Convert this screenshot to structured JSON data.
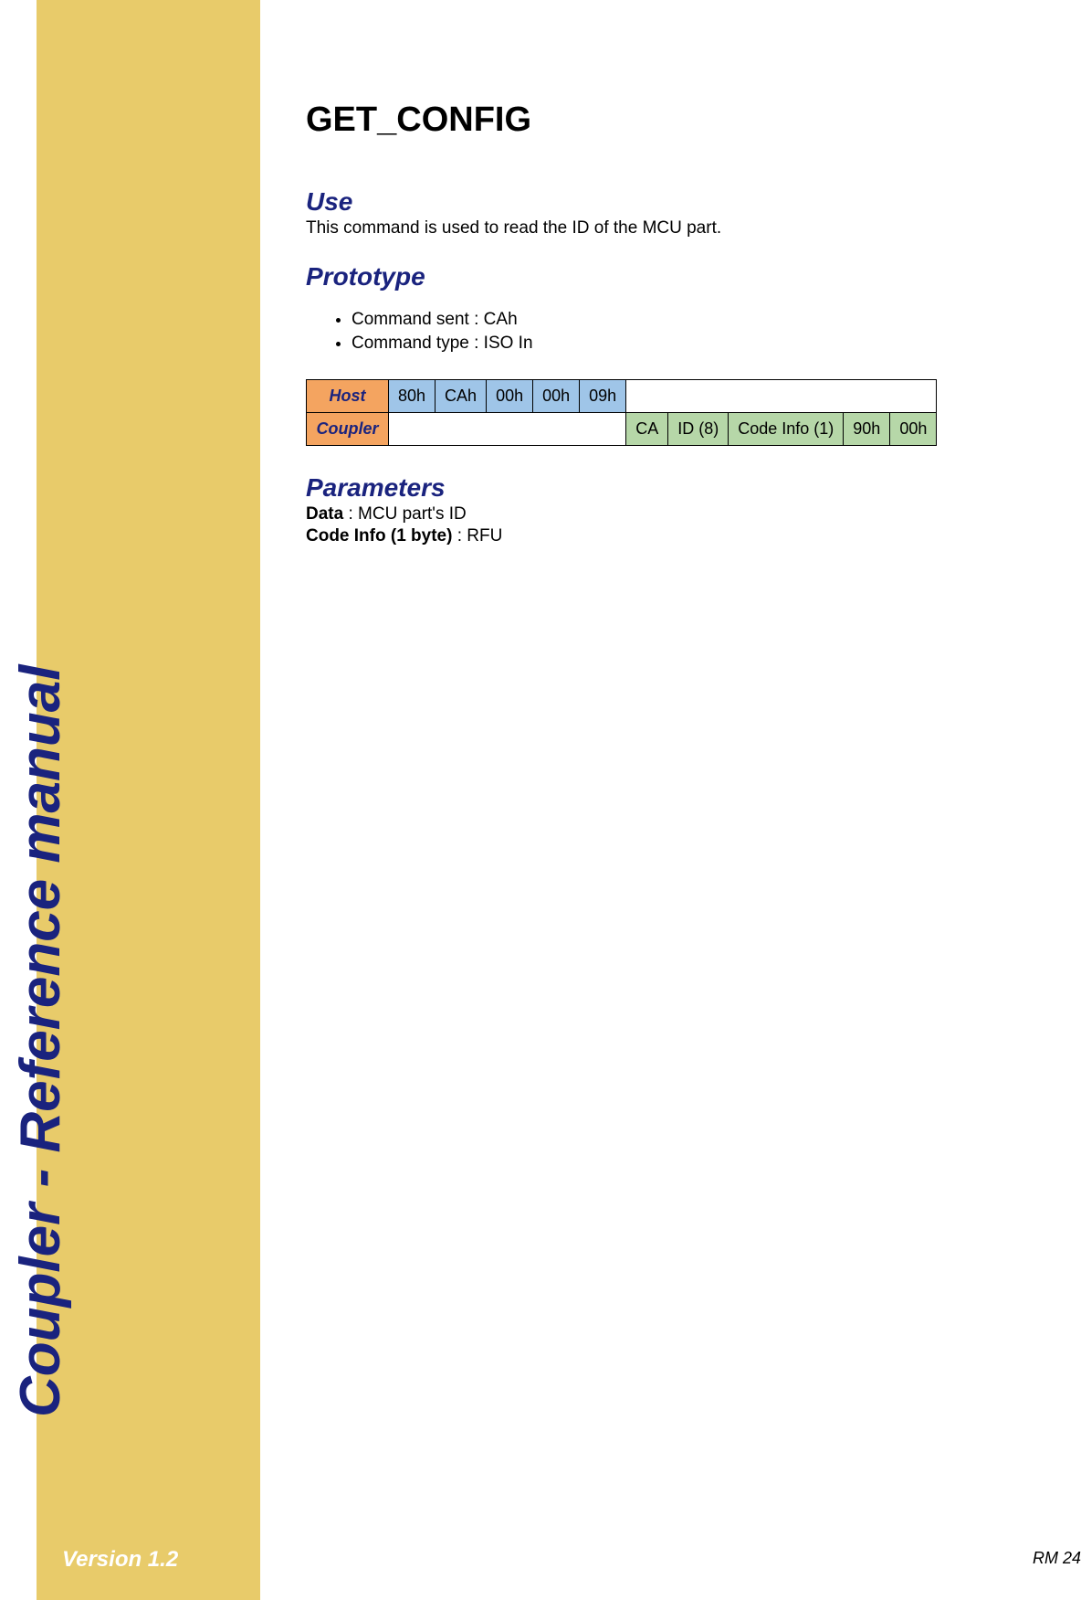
{
  "sidebar": {
    "title": "Coupler - Reference manual",
    "version": "Version 1.2"
  },
  "content": {
    "command_title": "GET_CONFIG",
    "use": {
      "heading": "Use",
      "text": "This command is used to read the ID of the MCU part."
    },
    "prototype": {
      "heading": "Prototype",
      "list": {
        "item0": "Command sent : CAh",
        "item1": "Command type : ISO In"
      },
      "table": {
        "host_label": "Host",
        "host_cells": {
          "c0": "80h",
          "c1": "CAh",
          "c2": "00h",
          "c3": "00h",
          "c4": "09h"
        },
        "coupler_label": "Coupler",
        "coupler_cells": {
          "c0": "CA",
          "c1": "ID (8)",
          "c2": "Code Info (1)",
          "c3": "90h",
          "c4": "00h"
        }
      }
    },
    "parameters": {
      "heading": "Parameters",
      "line1_label": "Data",
      "line1_value": " : MCU part's ID",
      "line2_label": "Code Info (1 byte)",
      "line2_value": " : RFU"
    }
  },
  "footer": {
    "page_ref": "RM 24"
  }
}
